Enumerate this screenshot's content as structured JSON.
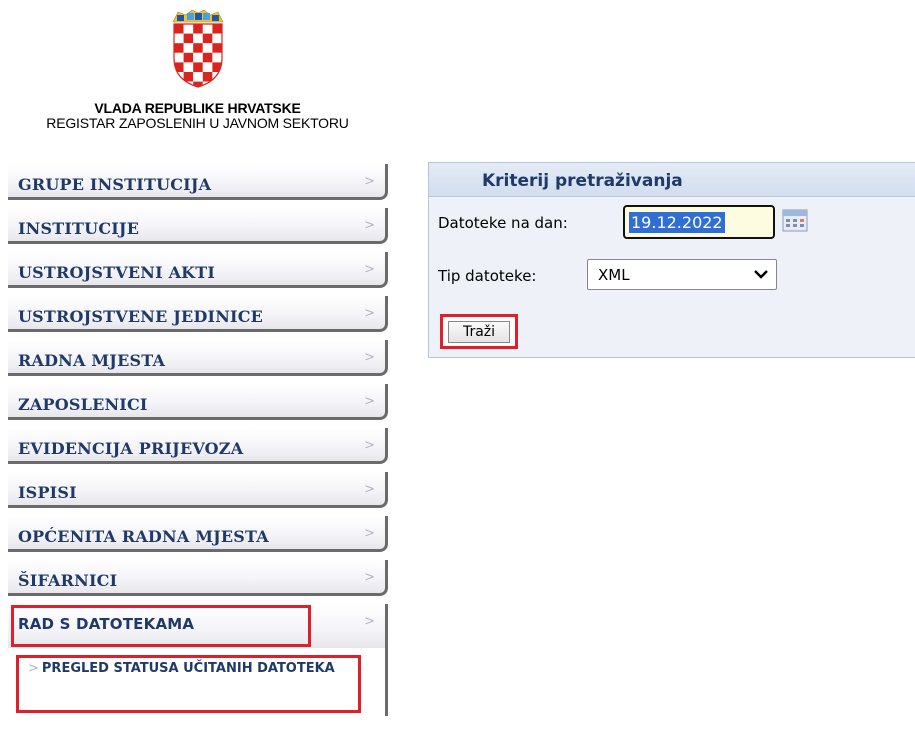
{
  "header": {
    "title": "VLADA REPUBLIKE HRVATSKE",
    "subtitle": "REGISTAR ZAPOSLENIH U JAVNOM SEKTORU",
    "crest_colors": {
      "red": "#d9251d",
      "white": "#ffffff",
      "blue": "#1e57a6",
      "gold": "#f1c232"
    }
  },
  "sidebar": {
    "items": [
      {
        "label": "GRUPE INSTITUCIJA",
        "chevron": ">"
      },
      {
        "label": "INSTITUCIJE",
        "chevron": ">"
      },
      {
        "label": "USTROJSTVENI AKTI",
        "chevron": ">"
      },
      {
        "label": "USTROJSTVENE JEDINICE",
        "chevron": ">"
      },
      {
        "label": "RADNA MJESTA",
        "chevron": ">"
      },
      {
        "label": "ZAPOSLENICI",
        "chevron": ">"
      },
      {
        "label": "EVIDENCIJA PRIJEVOZA",
        "chevron": ">"
      },
      {
        "label": "ISPISI",
        "chevron": ">"
      },
      {
        "label": "OPĆENITA RADNA MJESTA",
        "chevron": ">"
      },
      {
        "label": "ŠIFARNICI",
        "chevron": ">"
      },
      {
        "label": "RAD S DATOTEKAMA",
        "chevron": ">"
      }
    ],
    "submenu": {
      "chevron": ">",
      "label": "PREGLED STATUSA UČITANIH DATOTEKA"
    }
  },
  "search_panel": {
    "title": "Kriterij pretraživanja",
    "date_label": "Datoteke na dan:",
    "date_value": "19.12.2022",
    "type_label": "Tip datoteke:",
    "type_value": "XML",
    "search_button": "Traži"
  },
  "colors": {
    "menu_text": "#1f3a68",
    "highlight": "#e01f2d",
    "panel_bg": "#eef2f8",
    "selection": "#2f6fd3"
  }
}
